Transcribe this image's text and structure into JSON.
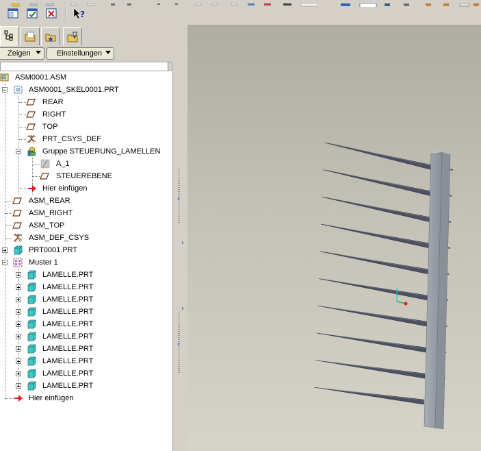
{
  "panel": {
    "show_button": "Zeigen",
    "settings_button": "Einstellungen"
  },
  "tree": {
    "root": "ASM0001.ASM",
    "skeleton": "ASM0001_SKEL0001.PRT",
    "skel_items": [
      "REAR",
      "RIGHT",
      "TOP",
      "PRT_CSYS_DEF"
    ],
    "group": "Gruppe STEUERUNG_LAMELLEN",
    "group_items": [
      "A_1",
      "STEUEREBENE"
    ],
    "insert_here": "Hier einfügen",
    "asm_items": [
      "ASM_REAR",
      "ASM_RIGHT",
      "ASM_TOP",
      "ASM_DEF_CSYS"
    ],
    "part": "PRT0001.PRT",
    "pattern": "Muster 1",
    "pattern_items": [
      "LAMELLE.PRT",
      "LAMELLE.PRT",
      "LAMELLE.PRT",
      "LAMELLE.PRT",
      "LAMELLE.PRT",
      "LAMELLE.PRT",
      "LAMELLE.PRT",
      "LAMELLE.PRT",
      "LAMELLE.PRT",
      "LAMELLE.PRT"
    ],
    "insert_here_bottom": "Hier einfügen"
  },
  "viewport": {
    "lamella_count": 10
  },
  "colors": {
    "part_icon": "#40c8c8",
    "insert_arrow": "#e02020",
    "lamella": "#4c5060",
    "post": "#9ea4ac"
  }
}
